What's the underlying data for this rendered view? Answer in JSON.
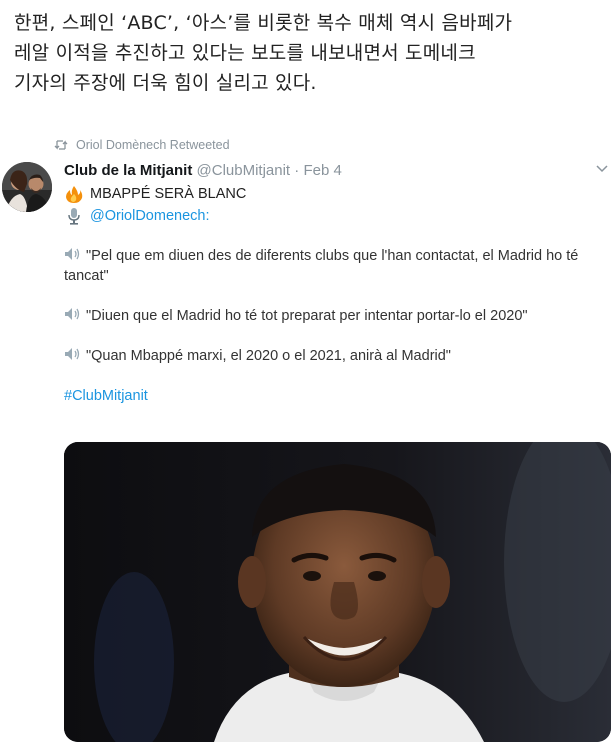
{
  "article": {
    "lines": [
      "한편, 스페인 ‘ABC’, ‘아스’를 비롯한 복수 매체 역시 음바페가",
      "레알 이적을 추진하고 있다는 보도를 내보내면서 도메네크",
      "기자의 주장에 더욱 힘이 실리고 있다."
    ]
  },
  "tweet": {
    "retweeted_by": "Oriol Domènech Retweeted",
    "display_name": "Club de la Mitjanit",
    "handle": "@ClubMitjanit",
    "separator": "·",
    "date": "Feb 4",
    "line1": "MBAPPÉ SERÀ BLANC",
    "mention": "@OriolDomenech:",
    "quotes": [
      "\"Pel que em diuen des de diferents clubs que l'han contactat, el Madrid ho té tancat\"",
      "\"Diuen que el Madrid ho té tot preparat per intentar portar-lo el 2020\"",
      "\"Quan Mbappé marxi, el 2020 o el 2021, anirà al Madrid\""
    ],
    "hashtag": "#ClubMitjanit"
  },
  "colors": {
    "link": "#1b95e0",
    "muted": "#8a949c",
    "text": "#14171a"
  },
  "icons": {
    "retweet": "retweet-icon",
    "fire": "fire-emoji-icon",
    "mic": "microphone-emoji-icon",
    "speaker": "speaker-emoji-icon",
    "caret": "chevron-down-icon"
  }
}
